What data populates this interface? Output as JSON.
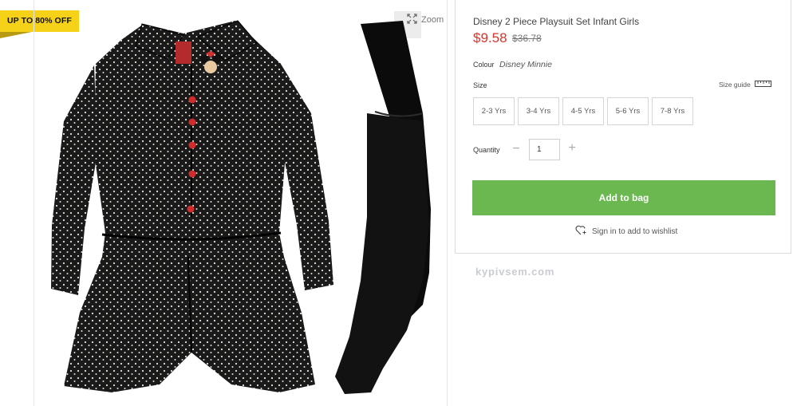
{
  "badge": {
    "label": "UP TO 80% OFF"
  },
  "gallery": {
    "zoom_label": "Zoom"
  },
  "product": {
    "title": "Disney 2 Piece Playsuit Set Infant Girls",
    "price": "$9.58",
    "old_price": "$36.78",
    "colour_label": "Colour",
    "colour_value": "Disney Minnie",
    "size_label": "Size",
    "size_guide_label": "Size guide",
    "sizes": [
      "2-3 Yrs",
      "3-4 Yrs",
      "4-5 Yrs",
      "5-6 Yrs",
      "7-8 Yrs"
    ],
    "quantity_label": "Quantity",
    "quantity_value": "1",
    "add_to_bag_label": "Add to bag",
    "wishlist_label": "Sign in to add to wishlist"
  },
  "watermark": "kypivsem.com",
  "colors": {
    "accent_green": "#6ab84f",
    "price_red": "#d9352c",
    "badge_yellow": "#f5d117"
  }
}
